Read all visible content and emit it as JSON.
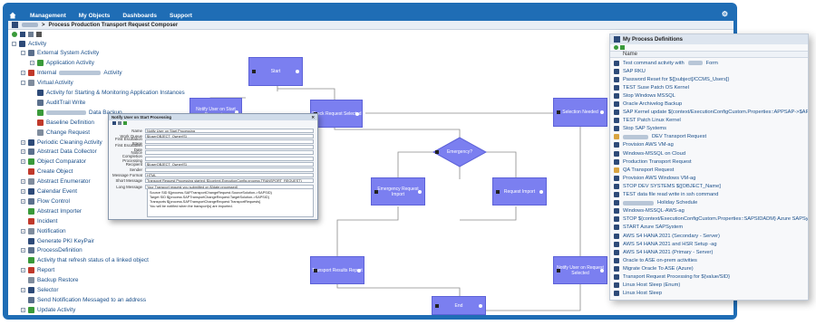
{
  "menu": {
    "items": [
      "Management",
      "My Objects",
      "Dashboards",
      "Support"
    ]
  },
  "title": {
    "breadcrumb_sep": ">",
    "text": "Process Production Transport Request Composer"
  },
  "tree": {
    "items": [
      {
        "label": "Activity",
        "level": 0,
        "exp": "-",
        "icon": "folder-icon"
      },
      {
        "label": "External System Activity",
        "level": 1,
        "exp": "-",
        "icon": "external-system-icon"
      },
      {
        "label": "Application Activity",
        "level": 2,
        "exp": "+",
        "icon": "application-icon"
      },
      {
        "label": "Internal",
        "suffix": "Activity",
        "level": 1,
        "exp": "+",
        "icon": "internal-icon",
        "blur": 46
      },
      {
        "label": "Virtual Activity",
        "level": 1,
        "exp": "-",
        "icon": "virtual-icon"
      },
      {
        "label": "Activity for Starting & Monitoring Application Instances",
        "level": 2,
        "exp": "",
        "icon": "monitor-icon"
      },
      {
        "label": "AuditTrail Write",
        "level": 2,
        "exp": "",
        "icon": "audit-icon"
      },
      {
        "label": "Data Backup",
        "level": 2,
        "exp": "",
        "icon": "backup-icon",
        "blur": 44,
        "prefix_blur": true
      },
      {
        "label": "Baseline Definition",
        "level": 2,
        "exp": "",
        "icon": "baseline-icon"
      },
      {
        "label": "Change Request",
        "level": 2,
        "exp": "",
        "icon": "change-icon"
      },
      {
        "label": "Periodic Cleaning Activity",
        "level": 1,
        "exp": "+",
        "icon": "cleaning-icon"
      },
      {
        "label": "Abstract Data Collector",
        "level": 1,
        "exp": "+",
        "icon": "collector-icon"
      },
      {
        "label": "Object Comparator",
        "level": 1,
        "exp": "+",
        "icon": "comparator-icon"
      },
      {
        "label": "Create Object",
        "level": 1,
        "exp": "",
        "icon": "create-icon"
      },
      {
        "label": "Abstract Enumerator",
        "level": 1,
        "exp": "+",
        "icon": "enumerator-icon"
      },
      {
        "label": "Calendar Event",
        "level": 1,
        "exp": "+",
        "icon": "calendar-icon"
      },
      {
        "label": "Flow Control",
        "level": 1,
        "exp": "+",
        "icon": "flow-icon"
      },
      {
        "label": "Abstract Importer",
        "level": 1,
        "exp": "",
        "icon": "importer-icon"
      },
      {
        "label": "Incident",
        "level": 1,
        "exp": "",
        "icon": "incident-icon"
      },
      {
        "label": "Notification",
        "level": 1,
        "exp": "+",
        "icon": "notification-icon"
      },
      {
        "label": "Generate PKI KeyPair",
        "level": 1,
        "exp": "",
        "icon": "key-icon"
      },
      {
        "label": "ProcessDefinition",
        "level": 1,
        "exp": "+",
        "icon": "process-icon"
      },
      {
        "label": "Activity that refresh status of a linked object",
        "level": 1,
        "exp": "",
        "icon": "refresh-icon"
      },
      {
        "label": "Report",
        "level": 1,
        "exp": "+",
        "icon": "report-icon"
      },
      {
        "label": "Backup Restore",
        "level": 1,
        "exp": "",
        "icon": "restore-icon"
      },
      {
        "label": "Selector",
        "level": 1,
        "exp": "+",
        "icon": "selector-icon"
      },
      {
        "label": "Send Notification Messaged to an address",
        "level": 1,
        "exp": "",
        "icon": "send-icon"
      },
      {
        "label": "Update Activity",
        "level": 1,
        "exp": "+",
        "icon": "update-icon"
      }
    ]
  },
  "canvas": {
    "nodes": {
      "start": "Start",
      "notify_start": "Notify User on Start Processing",
      "check_selected": "Check Request Selected",
      "selection_needed": "Selection Needed",
      "emergency": "Emergency?",
      "emergency_import": "Emergency Request Import",
      "request_import": "Request Import",
      "transport_report": "Transport Results Report",
      "notify_request": "Notify User on Request Selected",
      "end": "End"
    }
  },
  "dialog": {
    "title": "Notify User on Start Processing",
    "fields": [
      {
        "label": "Name",
        "value": "Notify User on Start Processing"
      },
      {
        "label": "Work Queue",
        "value": "${userOBJECT_Owner!S}"
      },
      {
        "label": "First Escalation Stage",
        "value": ""
      },
      {
        "label": "First Escalation Date",
        "value": ""
      },
      {
        "label": "Notice",
        "value": ""
      },
      {
        "label": "Completion Processing",
        "value": ""
      },
      {
        "label": "Recipient",
        "value": "${userOBJECT_Owner!S}"
      },
      {
        "label": "Sender",
        "value": ""
      },
      {
        "label": "Message Format",
        "value": "HTML"
      },
      {
        "label": "Short Message",
        "value": "Transport Request Processing started: ${context.ExecutionConfig.process.TRANSPORT_REQUEST}"
      },
      {
        "label": "Long Message",
        "value": "Your Transport request you submitted on ${date.processed}"
      }
    ],
    "notes": [
      "Source SID   ${process.SAPTransportChangeRequest.SourceSolution->SAPSID}",
      "Target SID   ${process.SAPTransportChangeRequest.TargetSolution->SAPSID}",
      "Transports   ${process.SAPTransportChangeRequest.TransportRequests}",
      "You will be notified when the transport(s) are imported."
    ]
  },
  "definitions": {
    "title": "My Process Definitions",
    "column": "Name",
    "items": [
      {
        "label": "Test command activity with",
        "suffix": "Form",
        "blur": 16
      },
      {
        "label": "SAP RKU"
      },
      {
        "label": "Password Reset for ${[subject]/CCMS_Users]}"
      },
      {
        "label": "TEST Suse Patch OS Kernel"
      },
      {
        "label": "Stop Windows MSSQL"
      },
      {
        "label": "Oracle Archivelog Backup"
      },
      {
        "label": "SAP Kernel update ${context/ExecutionConfigCustom.Properties::APPSAP->$AP.SID}"
      },
      {
        "label": "TEST Patch Linux Kernel"
      },
      {
        "label": "Stop SAP Systems"
      },
      {
        "label": "DEV Transport Request",
        "blur": 28,
        "prefix_blur": true,
        "folder": true
      },
      {
        "label": "Provision AWS VM-ag"
      },
      {
        "label": "Windows-MSSQL on Cloud"
      },
      {
        "label": "Production Transport Request"
      },
      {
        "label": "QA Transport Request",
        "folder": true
      },
      {
        "label": "Provision AWS Windows VM-ag"
      },
      {
        "label": "STOP DEV SYSTEMS ${[OBJECT_Name]"
      },
      {
        "label": "TEST data file read write in ssh command"
      },
      {
        "label": "Holiday Schedule",
        "blur": 34,
        "prefix_blur": true
      },
      {
        "label": "Windows-MSSQL-AWS-ag"
      },
      {
        "label": "STOP ${context/ExecutionConfigCustom.Properties::SAPSIDADM} Azure SAPSystem"
      },
      {
        "label": "START Azure SAPSystem"
      },
      {
        "label": "AWS S4 HANA 2021 (Secondary - Server)"
      },
      {
        "label": "AWS S4 HANA 2021 and HSR Setup -ag"
      },
      {
        "label": "AWS S4 HANA 2021 (Primary - Server)"
      },
      {
        "label": "Oracle to ASE on-prem activities"
      },
      {
        "label": "Migrate Oracle To ASE (Azure)"
      },
      {
        "label": "Transport Request Processing for ${value/SID}"
      },
      {
        "label": "Linux Host Sleep (Enum)"
      },
      {
        "label": "Linux Host Sleep"
      }
    ]
  }
}
